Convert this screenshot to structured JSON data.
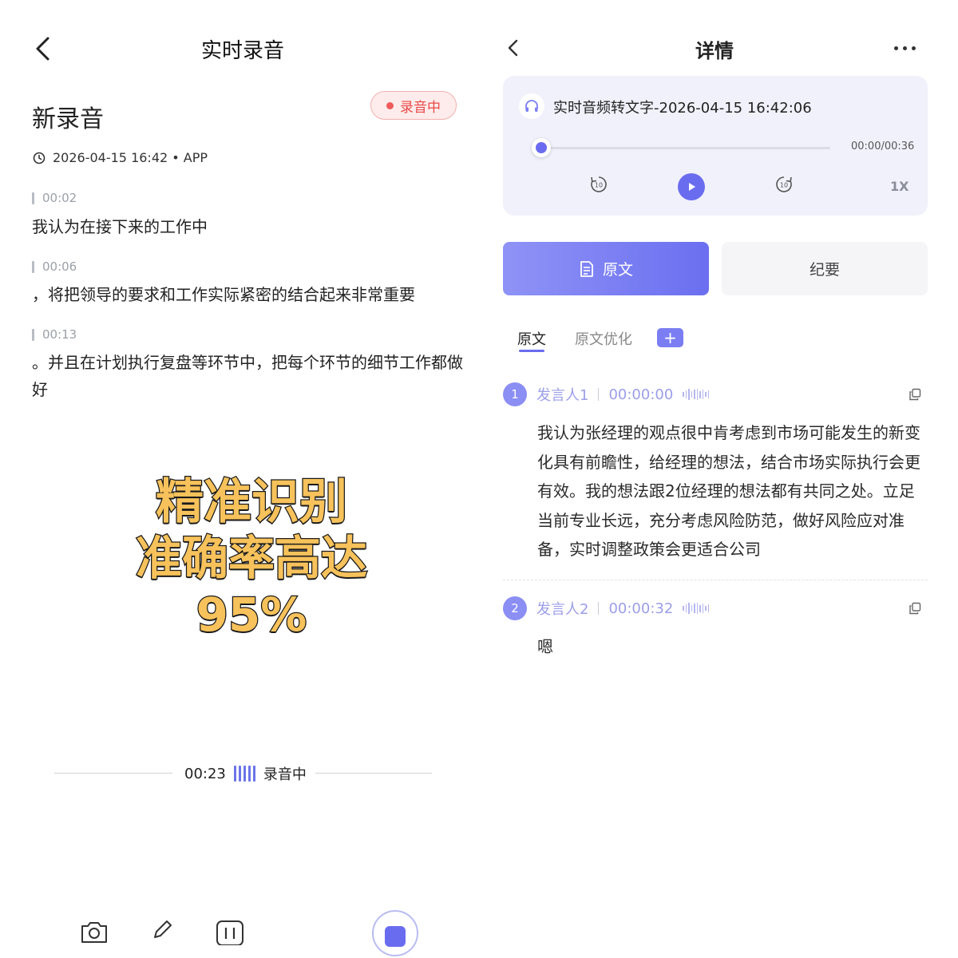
{
  "left": {
    "title": "实时录音",
    "recording_name": "新录音",
    "status_badge": "录音中",
    "meta": "2026-04-15 16:42 • APP",
    "segments": [
      {
        "time": "00:02",
        "text": "我认为在接下来的工作中"
      },
      {
        "time": "00:06",
        "text": "，将把领导的要求和工作实际紧密的结合起来非常重要"
      },
      {
        "time": "00:13",
        "text": "。并且在计划执行复盘等环节中，把每个环节的细节工作都做好"
      }
    ],
    "promo_line1": "精准识别",
    "promo_line2": "准确率高达95%",
    "elapsed": "00:23",
    "status_text": "录音中",
    "icons": [
      "camera-icon",
      "pen-icon",
      "pause-icon",
      "stop-icon"
    ]
  },
  "right": {
    "title": "详情",
    "audio_title": "实时音频转文字-2026-04-15 16:42:06",
    "time_readout": "00:00/00:36",
    "progress": 0,
    "rewind_label": "10",
    "forward_label": "10",
    "speed": "1X",
    "tab_original": "原文",
    "tab_summary": "纪要",
    "sub_tab_active": "原文",
    "sub_tab_optimize": "原文优化",
    "add_label": "+",
    "speakers": [
      {
        "num": "1",
        "name": "发言人1",
        "time": "00:00:00",
        "text": "我认为张经理的观点很中肯考虑到市场可能发生的新变化具有前瞻性，给经理的想法，结合市场实际执行会更有效。我的想法跟2位经理的想法都有共同之处。立足当前专业长远，充分考虑风险防范，做好风险应对准备，实时调整政策会更适合公司"
      },
      {
        "num": "2",
        "name": "发言人2",
        "time": "00:00:32",
        "text": "嗯"
      }
    ]
  },
  "colors": {
    "accent": "#6a6cf0",
    "record_red": "#e84848",
    "promo_fill": "#f7c25b"
  }
}
